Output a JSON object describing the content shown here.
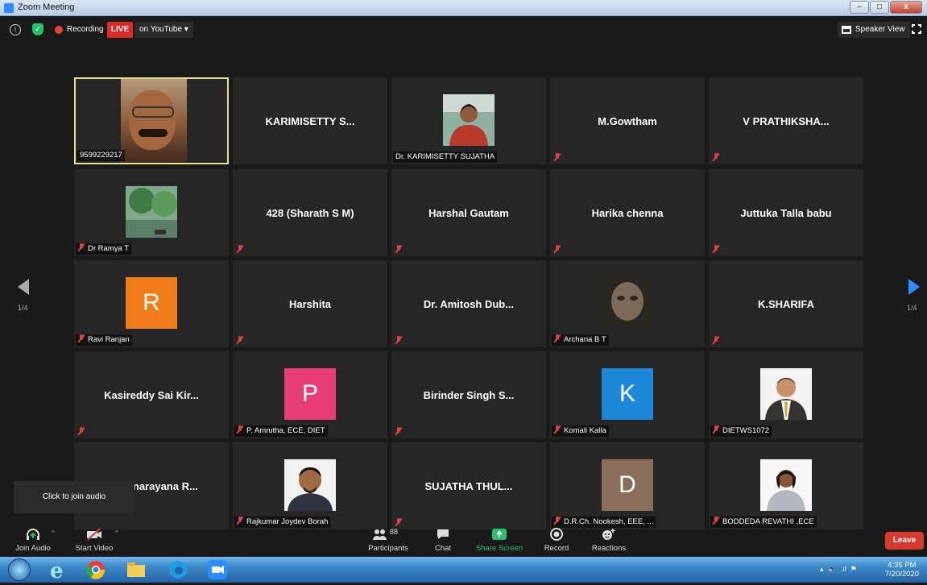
{
  "window": {
    "title": "Zoom Meeting",
    "buttons": [
      "–",
      "□",
      "x"
    ]
  },
  "topbar": {
    "recording_label": "Recording",
    "live_badge": "LIVE",
    "youtube_label": "on YouTube ▾",
    "speaker_view_label": "Speaker View"
  },
  "pagination": {
    "left": "1/4",
    "right": "1/4"
  },
  "participants": [
    {
      "id": "t1",
      "tag": "9599229217",
      "type": "video"
    },
    {
      "id": "t2",
      "big": "KARIMISETTY S...",
      "type": "name"
    },
    {
      "id": "t3",
      "tag": "Dr. KARIMISETTY SUJATHA",
      "type": "photo",
      "photo": "woman-portrait"
    },
    {
      "id": "t4",
      "big": "M.Gowtham",
      "type": "name",
      "muted": true
    },
    {
      "id": "t5",
      "big": "V PRATHIKSHA...",
      "type": "name",
      "muted": true
    },
    {
      "id": "t6",
      "tag": "Dr Ramya T",
      "type": "photo",
      "photo": "landscape",
      "muted": true
    },
    {
      "id": "t7",
      "big": "428 (Sharath S M)",
      "type": "name",
      "muted": true
    },
    {
      "id": "t8",
      "big": "Harshal Gautam",
      "type": "name",
      "muted": true
    },
    {
      "id": "t9",
      "big": "Harika chenna",
      "type": "name",
      "muted": true
    },
    {
      "id": "t10",
      "big": "Juttuka Talla babu",
      "type": "name",
      "muted": true
    },
    {
      "id": "t11",
      "tag": "Ravi Ranjan",
      "type": "avatar",
      "letter": "R",
      "color": "#f07c1a",
      "muted": true
    },
    {
      "id": "t12",
      "big": "Harshita",
      "type": "name",
      "muted": true
    },
    {
      "id": "t13",
      "big": "Dr. Amitosh Dub...",
      "type": "name",
      "muted": true
    },
    {
      "id": "t14",
      "tag": "Archana B T",
      "type": "photo",
      "photo": "blurred-face",
      "muted": true
    },
    {
      "id": "t15",
      "big": "K.SHARIFA",
      "type": "name",
      "muted": true
    },
    {
      "id": "t16",
      "big": "Kasireddy Sai Kir...",
      "type": "name",
      "muted": true
    },
    {
      "id": "t17",
      "tag": "P. Amrutha, ECE, DIET",
      "type": "avatar",
      "letter": "P",
      "color": "#e73d76",
      "muted": true
    },
    {
      "id": "t18",
      "big": "Birinder Singh S...",
      "type": "name",
      "muted": true
    },
    {
      "id": "t19",
      "tag": "Komali Kalla",
      "type": "avatar",
      "letter": "K",
      "color": "#1e88d8",
      "muted": true
    },
    {
      "id": "t20",
      "tag": "DIETWS1072",
      "type": "photo",
      "photo": "man-tie",
      "muted": true
    },
    {
      "id": "t21",
      "big": "Satyanarayana R...",
      "type": "name"
    },
    {
      "id": "t22",
      "tag": "Rajkumar Joydev Borah",
      "type": "photo",
      "photo": "man-portrait",
      "muted": true
    },
    {
      "id": "t23",
      "big": "SUJATHA THUL...",
      "type": "name",
      "muted": true
    },
    {
      "id": "t24",
      "tag": "D.R.Ch. Nookesh, EEE, ...",
      "type": "avatar",
      "letter": "D",
      "color": "#8b6d5c",
      "muted": true
    },
    {
      "id": "t25",
      "tag": "BODDEDA REVATHI ,ECE",
      "type": "photo",
      "photo": "woman-student",
      "muted": true
    }
  ],
  "tooltip": "Click to join audio",
  "toolbar": {
    "join_audio": "Join Audio",
    "start_video": "Start Video",
    "participants": "Participants",
    "participants_count": "88",
    "chat": "Chat",
    "share_screen": "Share Screen",
    "record": "Record",
    "reactions": "Reactions",
    "leave": "Leave"
  },
  "taskbar": {
    "time": "4:35 PM",
    "date": "7/20/2020"
  },
  "colors": {
    "active_border": "#e3e28a",
    "share_green": "#23c26b",
    "leave_red": "#d63a2f",
    "live_red": "#e02828"
  }
}
